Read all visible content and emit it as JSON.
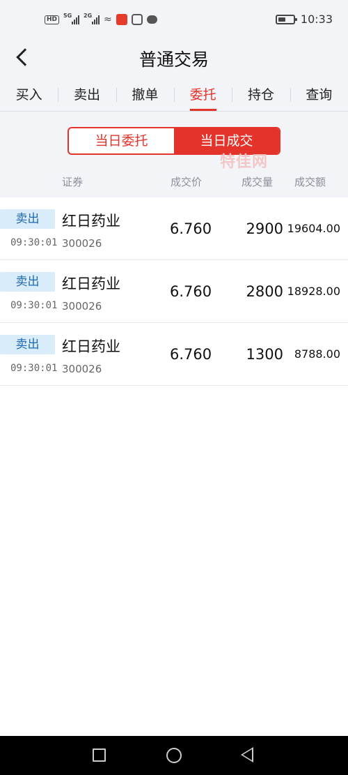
{
  "status_bar": {
    "hd": "HD",
    "net1": "5G",
    "net2": "2G",
    "time": "10:33"
  },
  "header": {
    "title": "普通交易"
  },
  "tabs": [
    {
      "label": "买入"
    },
    {
      "label": "卖出"
    },
    {
      "label": "撤单"
    },
    {
      "label": "委托"
    },
    {
      "label": "持仓"
    },
    {
      "label": "查询"
    }
  ],
  "segment": {
    "left": "当日委托",
    "right": "当日成交"
  },
  "watermark": "特佳网",
  "columns": {
    "security": "证券",
    "price": "成交价",
    "quantity": "成交量",
    "amount": "成交额"
  },
  "rows": [
    {
      "side": "卖出",
      "time": "09:30:01",
      "name": "红日药业",
      "code": "300026",
      "price": "6.760",
      "quantity": "2900",
      "amount": "19604.00"
    },
    {
      "side": "卖出",
      "time": "09:30:01",
      "name": "红日药业",
      "code": "300026",
      "price": "6.760",
      "quantity": "2800",
      "amount": "18928.00"
    },
    {
      "side": "卖出",
      "time": "09:30:01",
      "name": "红日药业",
      "code": "300026",
      "price": "6.760",
      "quantity": "1300",
      "amount": "8788.00"
    }
  ],
  "colors": {
    "accent": "#e4332a",
    "badge_bg": "#d9ecfa",
    "badge_text": "#1f68b3"
  },
  "icons": {
    "back": "chevron-left-icon",
    "nav_recent": "square-icon",
    "nav_home": "circle-icon",
    "nav_back": "triangle-back-icon"
  }
}
